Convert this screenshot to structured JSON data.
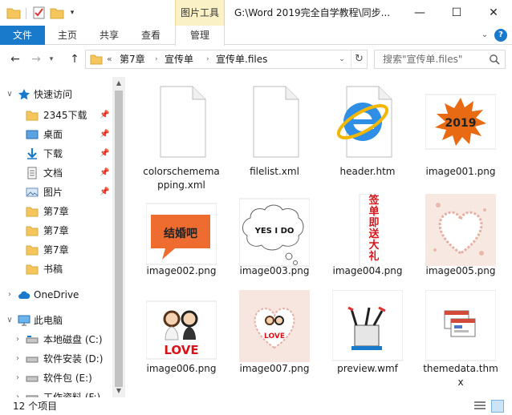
{
  "window": {
    "context_tab": "图片工具",
    "title": "G:\\Word 2019完全自学教程\\同步...",
    "minimize": "—",
    "maximize": "☐",
    "close": "✕"
  },
  "ribbon": {
    "tabs": [
      "文件",
      "主页",
      "共享",
      "查看",
      "管理"
    ],
    "help": "?"
  },
  "address": {
    "overflow": "«",
    "crumbs": [
      "第7章",
      "宣传单",
      "宣传单.files"
    ]
  },
  "search": {
    "placeholder": "搜索\"宣传单.files\""
  },
  "navpane": {
    "quick_access": "快速访问",
    "items": [
      {
        "label": "2345下载",
        "icon": "folder-icon",
        "pinned": true
      },
      {
        "label": "桌面",
        "icon": "desktop-icon",
        "pinned": true
      },
      {
        "label": "下载",
        "icon": "download-icon",
        "pinned": true
      },
      {
        "label": "文档",
        "icon": "documents-icon",
        "pinned": true
      },
      {
        "label": "图片",
        "icon": "pictures-icon",
        "pinned": true
      },
      {
        "label": "第7章",
        "icon": "folder-icon",
        "pinned": false
      },
      {
        "label": "第7章",
        "icon": "folder-icon",
        "pinned": false
      },
      {
        "label": "第7章",
        "icon": "folder-icon",
        "pinned": false
      },
      {
        "label": "书稿",
        "icon": "folder-icon",
        "pinned": false
      }
    ],
    "onedrive": "OneDrive",
    "this_pc": "此电脑",
    "drives": [
      {
        "label": "本地磁盘 (C:)"
      },
      {
        "label": "软件安装 (D:)"
      },
      {
        "label": "软件包 (E:)"
      },
      {
        "label": "工作资料 (F:)"
      }
    ]
  },
  "files": [
    {
      "name": "colorschememapping.xml",
      "caption_lines": [
        "colorschemema",
        "pping.xml"
      ],
      "icon": "blank-file-icon"
    },
    {
      "name": "filelist.xml",
      "caption_lines": [
        "filelist.xml"
      ],
      "icon": "blank-file-icon"
    },
    {
      "name": "header.htm",
      "caption_lines": [
        "header.htm"
      ],
      "icon": "internet-explorer-icon"
    },
    {
      "name": "image001.png",
      "caption_lines": [
        "image001.png"
      ],
      "icon": "image-thumbnail",
      "thumb_text": "2019"
    },
    {
      "name": "image002.png",
      "caption_lines": [
        "image002.png"
      ],
      "icon": "image-thumbnail",
      "thumb_text": "结婚吧"
    },
    {
      "name": "image003.png",
      "caption_lines": [
        "image003.png"
      ],
      "icon": "image-thumbnail",
      "thumb_text": "YES I DO"
    },
    {
      "name": "image004.png",
      "caption_lines": [
        "image004.png"
      ],
      "icon": "image-thumbnail",
      "thumb_text": "签单即送大礼"
    },
    {
      "name": "image005.png",
      "caption_lines": [
        "image005.png"
      ],
      "icon": "image-thumbnail"
    },
    {
      "name": "image006.png",
      "caption_lines": [
        "image006.png"
      ],
      "icon": "image-thumbnail",
      "thumb_text": "LOVE"
    },
    {
      "name": "image007.png",
      "caption_lines": [
        "image007.png"
      ],
      "icon": "image-thumbnail",
      "thumb_text": "LOVE"
    },
    {
      "name": "preview.wmf",
      "caption_lines": [
        "preview.wmf"
      ],
      "icon": "wmf-file-icon"
    },
    {
      "name": "themedata.thmx",
      "caption_lines": [
        "themedata.thm",
        "x"
      ],
      "icon": "theme-file-icon"
    }
  ],
  "status": {
    "count": "12 个项目"
  },
  "colors": {
    "accent": "#1979ca",
    "context_tab_bg": "#fbf1c6",
    "folder": "#f5c65b"
  }
}
